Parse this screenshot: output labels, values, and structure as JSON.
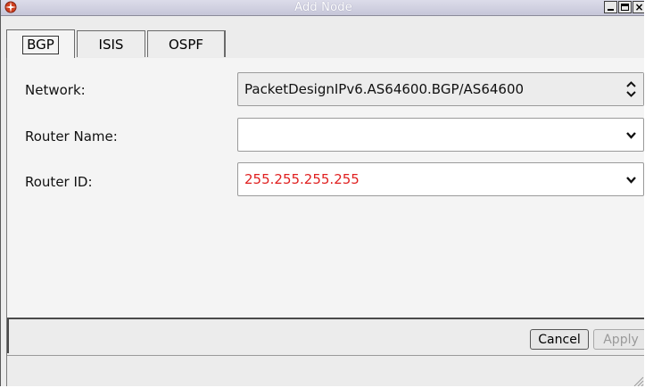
{
  "window": {
    "title": "Add Node",
    "app_icon": "compass-rose-icon",
    "controls": [
      "minimize-icon",
      "maximize-icon",
      "close-icon"
    ],
    "close_glyph": "×"
  },
  "tabs": [
    {
      "label": "BGP",
      "selected": true
    },
    {
      "label": "ISIS",
      "selected": false
    },
    {
      "label": "OSPF",
      "selected": false
    }
  ],
  "form": {
    "network": {
      "label": "Network:",
      "value": "PacketDesignIPv6.AS64600.BGP/AS64600",
      "control_icon": "up-down-spinner-icon"
    },
    "router_name": {
      "label": "Router Name:",
      "value": "",
      "control_icon": "chevron-down-icon"
    },
    "router_id": {
      "label": "Router ID:",
      "value": "255.255.255.255",
      "value_color": "#e02020",
      "control_icon": "chevron-down-icon"
    }
  },
  "buttons": {
    "cancel_label": "Cancel",
    "apply_label": "Apply",
    "apply_enabled": false
  }
}
